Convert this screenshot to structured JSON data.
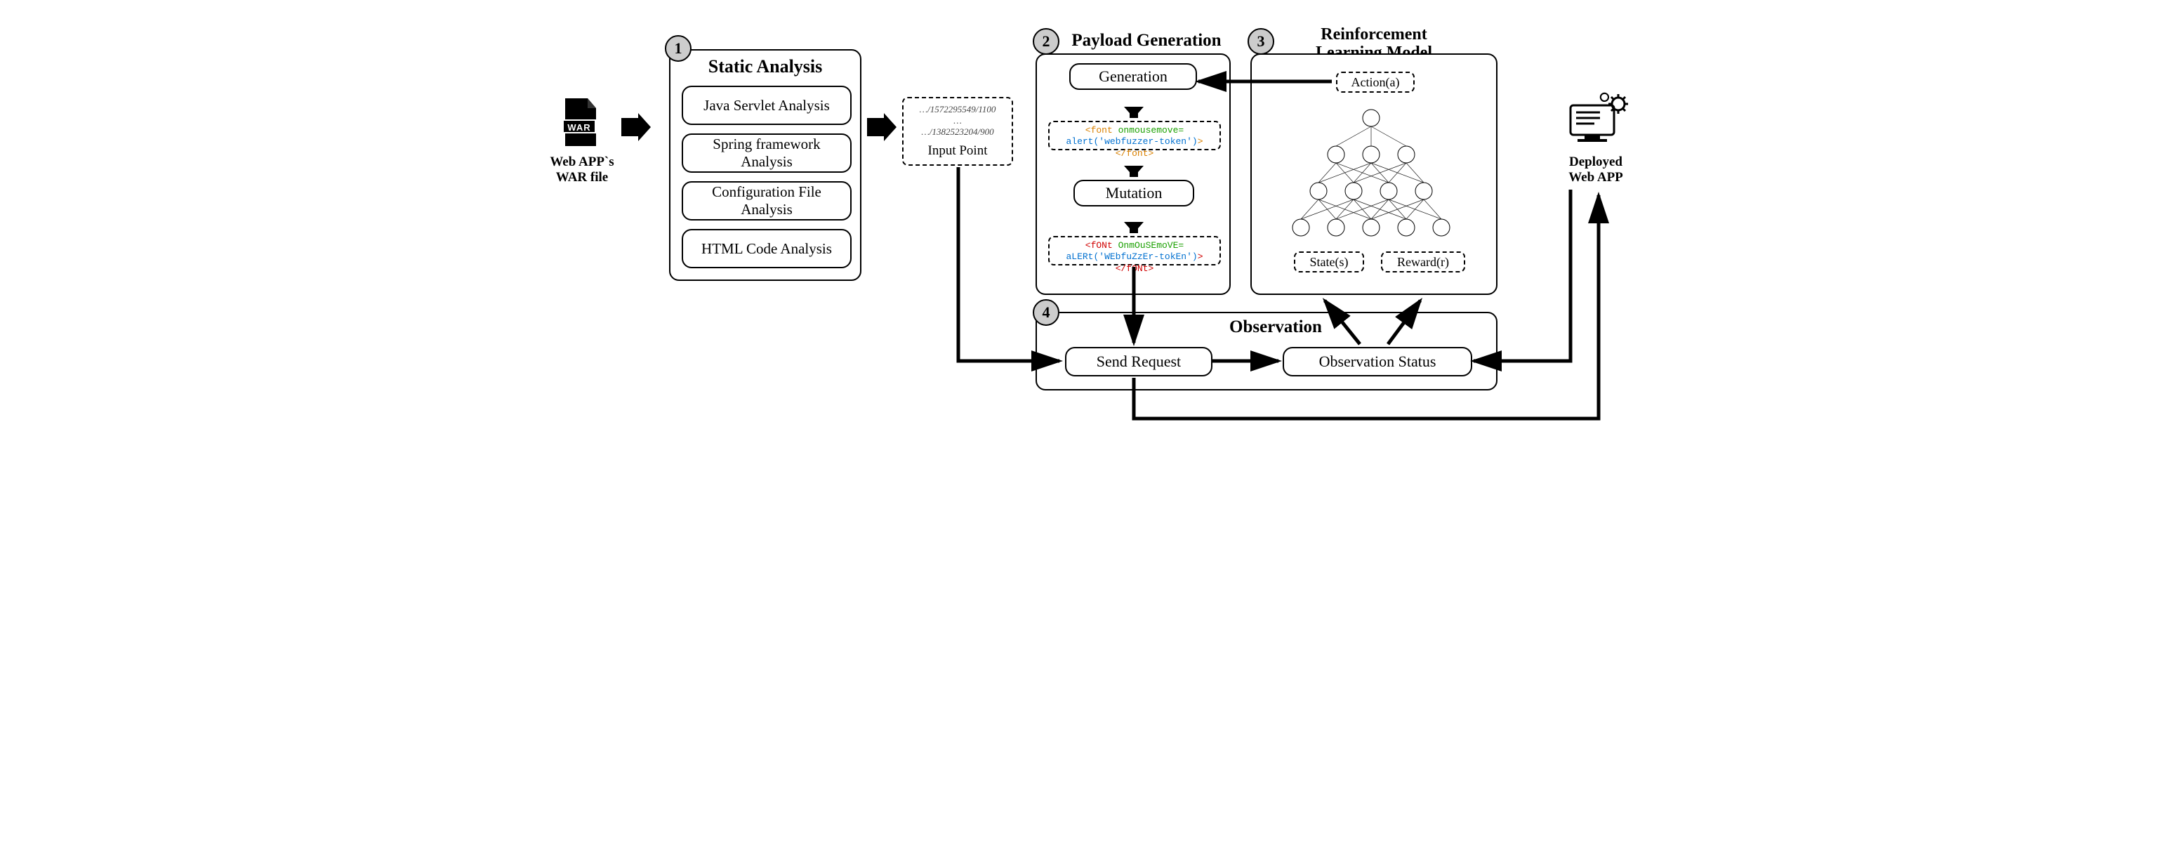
{
  "inputs": {
    "war_label": "Web APP`s\nWAR file",
    "war_badge": "WAR",
    "deployed_label": "Deployed\nWeb APP"
  },
  "panel1": {
    "num": "1",
    "title": "Static Analysis",
    "items": [
      "Java Servlet Analysis",
      "Spring framework Analysis",
      "Configuration File Analysis",
      "HTML Code Analysis"
    ]
  },
  "input_point": {
    "lines": [
      "…/1572295549/1100",
      "…",
      "…/1382523204/900"
    ],
    "label": "Input Point"
  },
  "panel2": {
    "num": "2",
    "title": "Payload Generation",
    "generation": "Generation",
    "mutation": "Mutation",
    "payload_gen": {
      "open_tag": "<font",
      "handler": " onmousemove=",
      "body": "alert('webfuzzer-token')",
      "close": "></font>"
    },
    "payload_mut": {
      "open_tag": "<fONt",
      "handler": " OnmOuSEmoVE=",
      "body": "aLERt('WEbfuZzEr-tokEn')",
      "close": "></fONt>"
    }
  },
  "panel3": {
    "num": "3",
    "title": "Reinforcement\nLearning Model",
    "action": "Action(a)",
    "state": "State(s)",
    "reward": "Reward(r)"
  },
  "panel4": {
    "num": "4",
    "title": "Observation",
    "send": "Send Request",
    "obs": "Observation Status"
  }
}
